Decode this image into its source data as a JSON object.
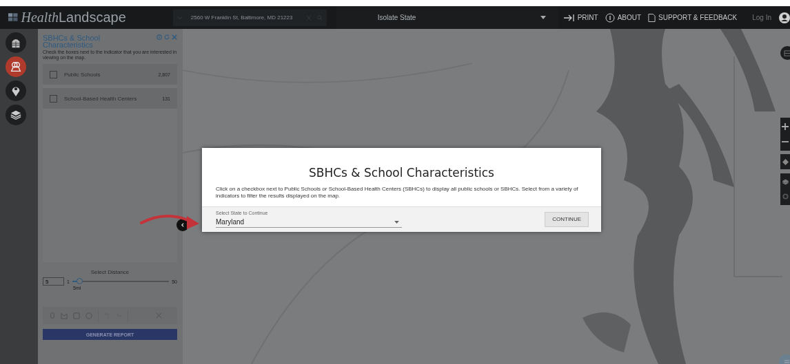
{
  "header": {
    "logo": {
      "part_1": "Health",
      "part_2": "Landscape"
    },
    "search": {
      "value": "2560 W Franklin St, Baltimore, MD 21223"
    },
    "isolate_dropdown": {
      "value": "Isolate State"
    },
    "links": [
      {
        "kind": "print",
        "label": "PRINT"
      },
      {
        "kind": "about",
        "label": "ABOUT"
      },
      {
        "kind": "support",
        "label": "SUPPORT & FEEDBACK"
      }
    ],
    "login": "Log In"
  },
  "rail": [
    {
      "kind": "building",
      "selected": false
    },
    {
      "kind": "school",
      "selected": true
    },
    {
      "kind": "pin",
      "selected": false
    },
    {
      "kind": "layers",
      "selected": false
    }
  ],
  "panel": {
    "title": "SBHCs & School Characteristics",
    "description": "Check the boxes next to the indicator that you are interested in viewing on the map.",
    "indicators": [
      {
        "label": "Public Schools",
        "count": "2,807",
        "checked": false
      },
      {
        "label": "School-Based Health Centers",
        "count": "131",
        "checked": false
      }
    ],
    "distance": {
      "label": "Select Distance",
      "value": "5",
      "min": "1",
      "max": "50",
      "reading": "5mi",
      "level": 0.08
    },
    "generate_button": "GENERATE REPORT"
  },
  "modal": {
    "title": "SBHCs & School Characteristics",
    "text": "Click on a checkbox next to Public Schools or School-Based Health Centers (SBHCs) to display all public schools or SBHCs. Select from a variety of indicators to filter the results displayed on the map.",
    "select": {
      "label": "Select State to Continue",
      "value": "Maryland"
    },
    "button": "CONTINUE"
  }
}
